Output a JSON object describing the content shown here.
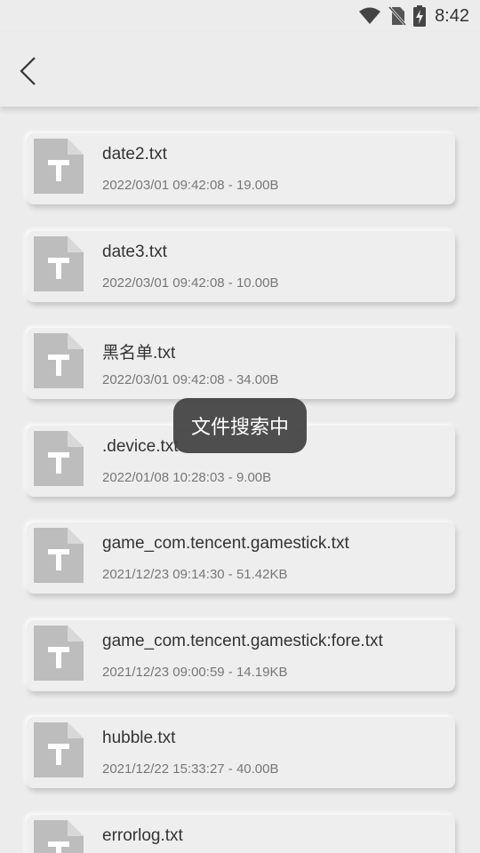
{
  "status_bar": {
    "time": "8:42",
    "icons": [
      "wifi-icon",
      "no-sim-icon",
      "battery-charging-icon"
    ]
  },
  "app_bar": {
    "back_icon": "back-arrow-icon"
  },
  "files": [
    {
      "name": "date2.txt",
      "meta": "2022/03/01 09:42:08 - 19.00B",
      "icon": "text-file-icon"
    },
    {
      "name": "date3.txt",
      "meta": "2022/03/01 09:42:08 - 10.00B",
      "icon": "text-file-icon"
    },
    {
      "name": "黑名单.txt",
      "meta": "2022/03/01 09:42:08 - 34.00B",
      "icon": "text-file-icon"
    },
    {
      "name": ".device.txt",
      "meta": "2022/01/08 10:28:03 - 9.00B",
      "icon": "text-file-icon"
    },
    {
      "name": "game_com.tencent.gamestick.txt",
      "meta": "2021/12/23 09:14:30 - 51.42KB",
      "icon": "text-file-icon"
    },
    {
      "name": "game_com.tencent.gamestick:fore.txt",
      "meta": "2021/12/23 09:00:59 - 14.19KB",
      "icon": "text-file-icon"
    },
    {
      "name": "hubble.txt",
      "meta": "2021/12/22 15:33:27 - 40.00B",
      "icon": "text-file-icon"
    },
    {
      "name": "errorlog.txt",
      "meta": "",
      "icon": "text-file-icon"
    }
  ],
  "toast": {
    "text": "文件搜索中"
  }
}
